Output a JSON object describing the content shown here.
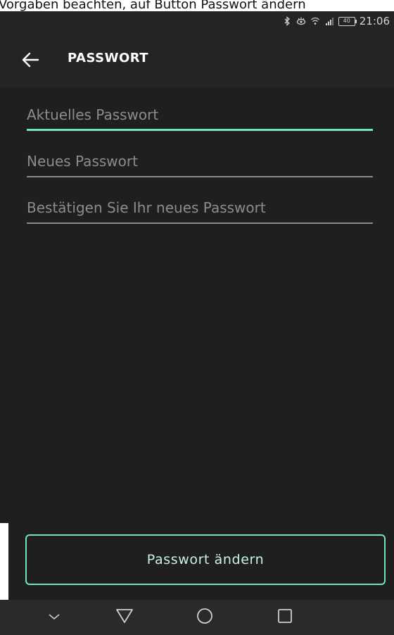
{
  "document": {
    "caption": "Vorgaben beachten, auf Button Passwort ändern"
  },
  "status_bar": {
    "time": "21:06",
    "battery": "40",
    "icons": [
      "bluetooth-icon",
      "eye-icon",
      "wifi-icon",
      "signal-icon",
      "battery-icon"
    ]
  },
  "header": {
    "title": "PASSWORT",
    "back_icon": "arrow-left-icon"
  },
  "form": {
    "current_password": {
      "placeholder": "Aktuelles Passwort",
      "value": ""
    },
    "new_password": {
      "placeholder": "Neues Passwort",
      "value": ""
    },
    "confirm_password": {
      "placeholder": "Bestätigen Sie Ihr neues Passwort",
      "value": ""
    }
  },
  "actions": {
    "submit_label": "Passwort ändern"
  },
  "nav_bar": {
    "icons": [
      "chevron-down-icon",
      "triangle-back-icon",
      "circle-home-icon",
      "square-recents-icon"
    ]
  },
  "colors": {
    "background": "#1f1f1f",
    "app_bar": "#242424",
    "accent": "#6fe4c6",
    "text": "#ffffff",
    "placeholder": "#8c8c8c"
  }
}
